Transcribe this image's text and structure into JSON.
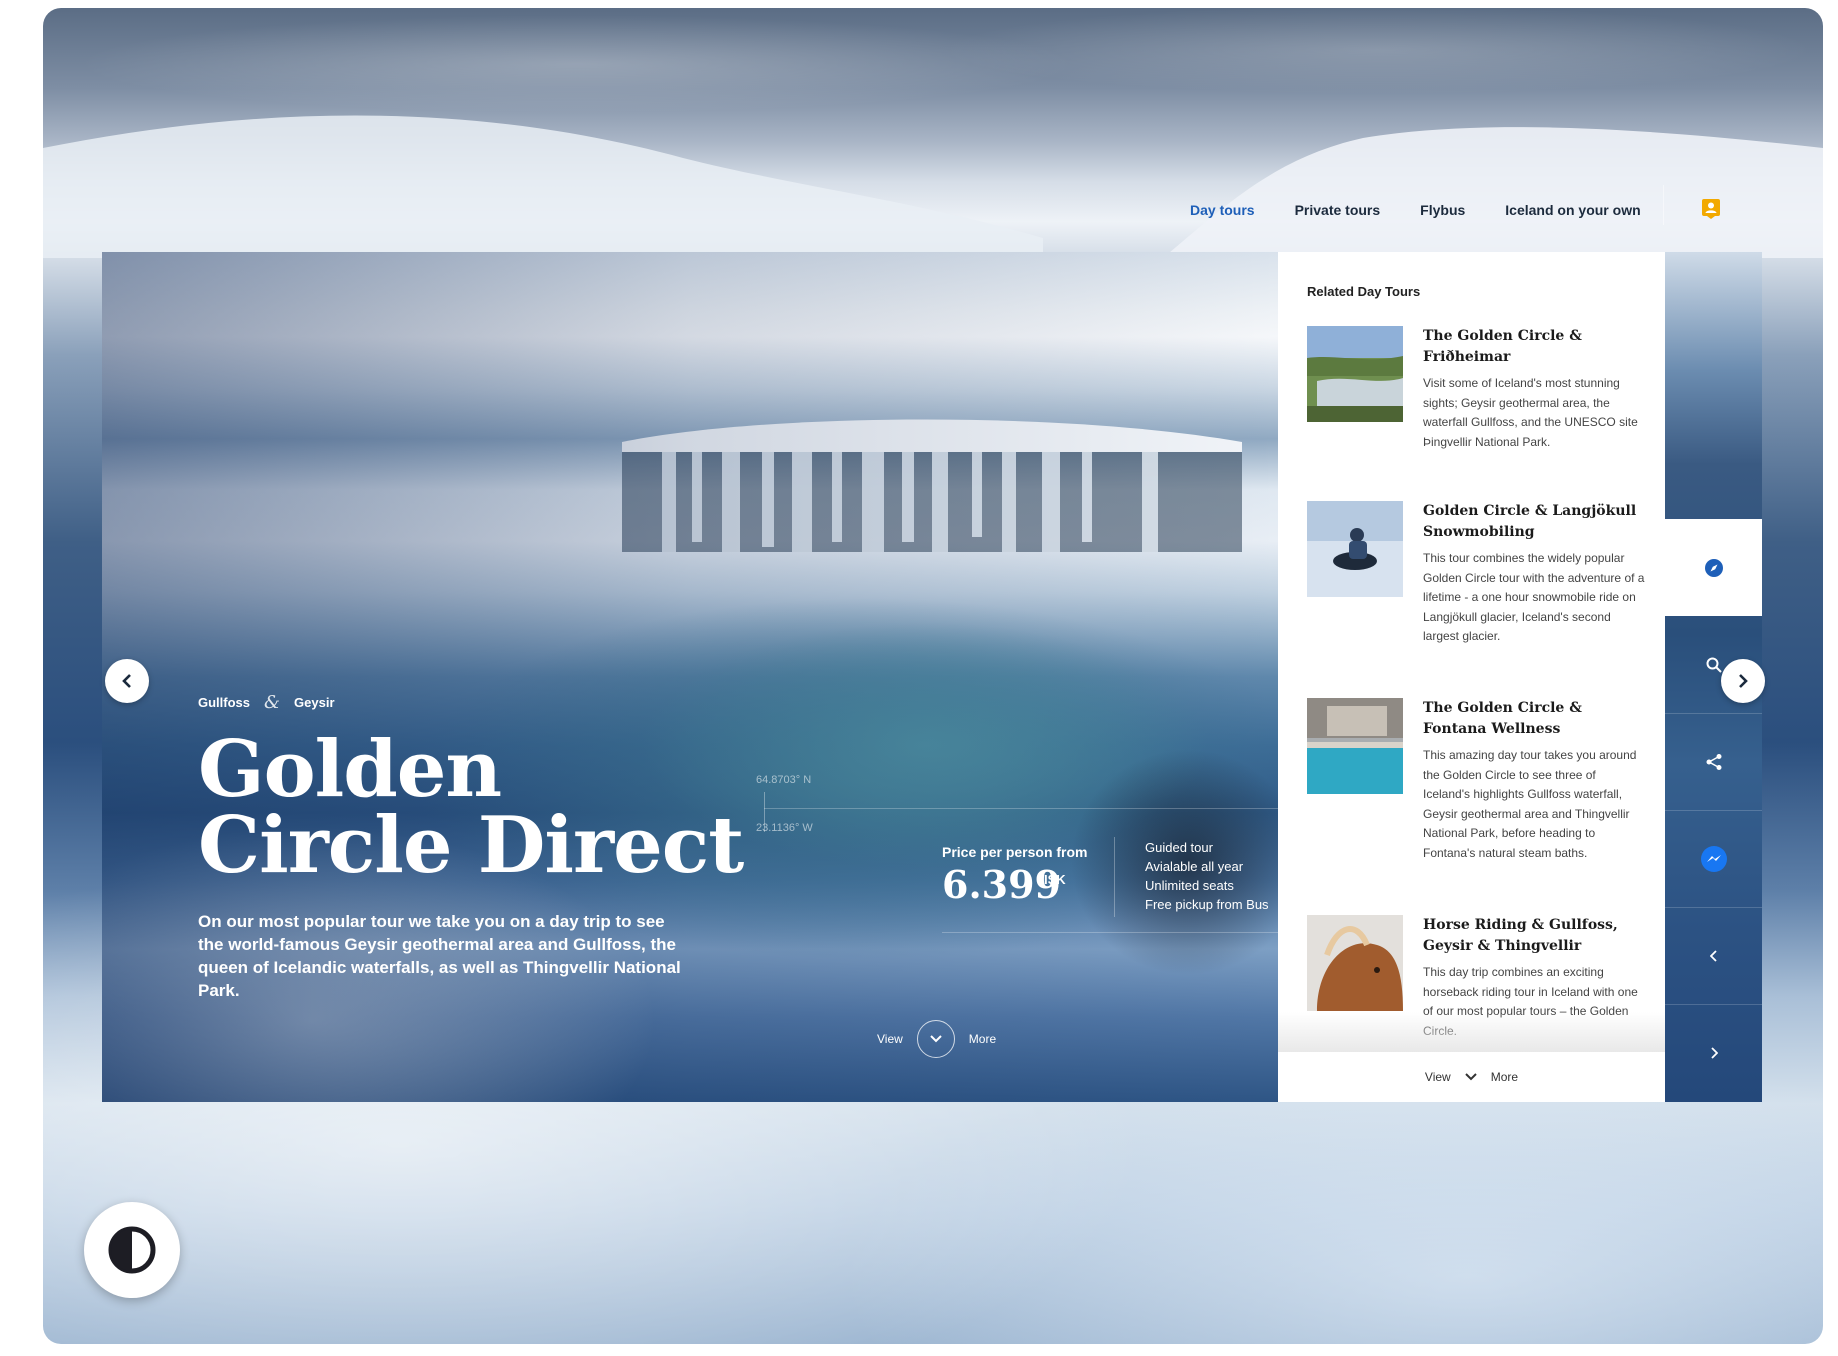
{
  "nav": {
    "items": [
      {
        "label": "Day tours",
        "active": true
      },
      {
        "label": "Private tours",
        "active": false
      },
      {
        "label": "Flybus",
        "active": false
      },
      {
        "label": "Iceland on your own",
        "active": false
      }
    ],
    "account_icon": "user-badge-icon"
  },
  "hero": {
    "subtitle_left": "Gullfoss",
    "subtitle_amp": "&",
    "subtitle_right": "Geysir",
    "title": "Golden Circle Direct",
    "description": "On our most popular tour we take you on a day trip to see the world-famous Geysir geothermal area and Gullfoss, the queen of Icelandic waterfalls, as well as Thingvellir National Park.",
    "coord_lat": "64.8703° N",
    "coord_lon": "23.1136° W",
    "price_label": "Price per person from",
    "price_value": "6.399",
    "price_currency": "ISK",
    "features": [
      "Guided tour",
      "Avialable all year",
      "Unlimited seats",
      "Free pickup from Bus"
    ],
    "view_label": "View",
    "more_label": "More"
  },
  "related": {
    "heading": "Related Day Tours",
    "tours": [
      {
        "title": "The Golden Circle & Friðheimar",
        "text": "Visit some of Iceland's most stunning sights; Geysir geothermal area, the waterfall Gullfoss, and the UNESCO site Þingvellir National Park."
      },
      {
        "title": "Golden Circle & Langjökull Snowmobiling",
        "text": "This tour combines the widely popular Golden Circle tour with the adventure of a lifetime - a one hour snowmobile ride on Langjökull glacier, Iceland's second largest glacier."
      },
      {
        "title": "The Golden Circle & Fontana Wellness",
        "text": "This amazing day tour takes you around the Golden Circle to see three of Iceland's highlights Gullfoss waterfall, Geysir geothermal area and Thingvellir National Park, before heading to Fontana's natural steam baths."
      },
      {
        "title": "Horse Riding & Gullfoss, Geysir & Thingvellir",
        "text": "This day trip combines an exciting horseback riding tour in Iceland with one of our most popular tours – the Golden Circle."
      }
    ],
    "view_label": "View",
    "more_label": "More"
  },
  "side_strip": {
    "icons": [
      "compass-icon",
      "search-icon",
      "share-icon",
      "messenger-icon",
      "chevron-left-icon",
      "chevron-right-icon"
    ]
  },
  "colors": {
    "accent": "#1e5fb8",
    "account": "#f2a900",
    "messenger": "#1877f2"
  },
  "contrast_icon": "contrast-toggle-icon"
}
